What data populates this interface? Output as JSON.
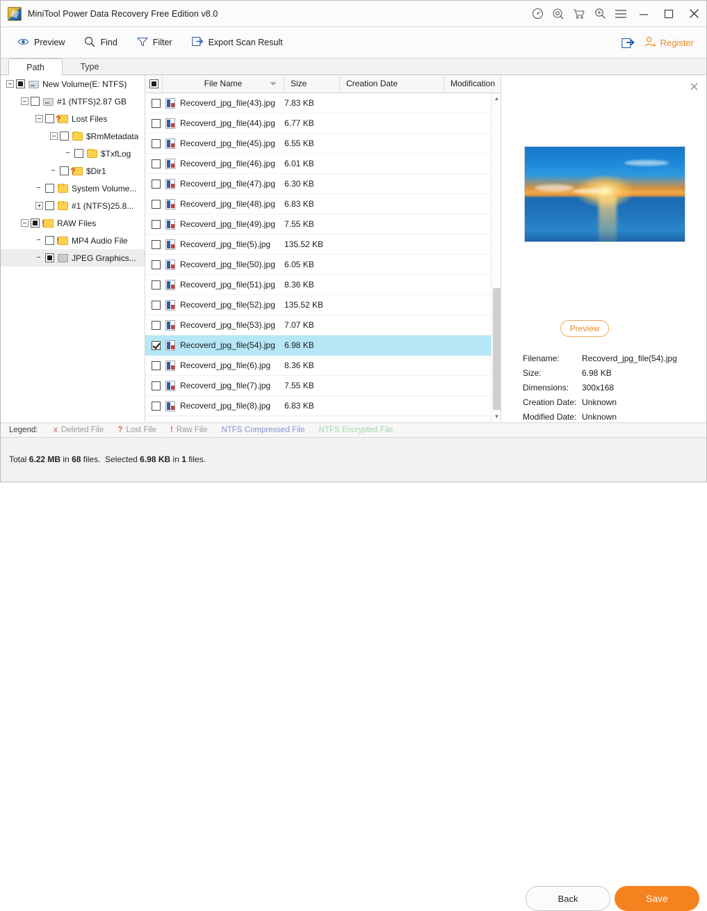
{
  "window": {
    "title": "MiniTool Power Data Recovery Free Edition v8.0",
    "icons": {
      "app": "app-logo-icon",
      "disk": "disk-benchmark-icon",
      "support": "support-icon",
      "cart": "shopping-cart-icon",
      "magnifier": "magnifier-plus-icon",
      "menu": "hamburger-menu-icon",
      "minimize": "minimize-icon",
      "maximize": "maximize-icon",
      "close": "close-icon"
    }
  },
  "toolbar": {
    "preview": "Preview",
    "find": "Find",
    "filter": "Filter",
    "export": "Export Scan Result",
    "share": "share-export-icon",
    "register": "Register"
  },
  "tabs": [
    {
      "label": "Path",
      "active": true
    },
    {
      "label": "Type",
      "active": false
    }
  ],
  "tree": [
    {
      "label": "New Volume(E: NTFS)",
      "indent": 0,
      "expander": "minus",
      "check": "filled",
      "icon": "drive",
      "selected": false
    },
    {
      "label": "#1 (NTFS)2.87 GB",
      "indent": 1,
      "expander": "minus",
      "check": "empty",
      "icon": "drive",
      "selected": false
    },
    {
      "label": "Lost Files",
      "indent": 2,
      "expander": "minus",
      "check": "empty",
      "icon": "quest",
      "selected": false
    },
    {
      "label": "$RmMetadata",
      "indent": 3,
      "expander": "minus",
      "check": "empty",
      "icon": "folder",
      "selected": false
    },
    {
      "label": "$TxfLog",
      "indent": 4,
      "expander": "none",
      "check": "empty",
      "icon": "folder",
      "selected": false
    },
    {
      "label": "$Dir1",
      "indent": 3,
      "expander": "none",
      "check": "empty",
      "icon": "quest",
      "selected": false
    },
    {
      "label": "System Volume...",
      "indent": 2,
      "expander": "none",
      "check": "empty",
      "icon": "folder",
      "selected": false
    },
    {
      "label": "#1 (NTFS)25.8...",
      "indent": 2,
      "expander": "plus",
      "check": "empty",
      "icon": "folder",
      "selected": false
    },
    {
      "label": "RAW Files",
      "indent": 1,
      "expander": "minus",
      "check": "filled",
      "icon": "warn",
      "selected": false
    },
    {
      "label": "MP4 Audio File",
      "indent": 2,
      "expander": "none",
      "check": "empty",
      "icon": "warn",
      "selected": false
    },
    {
      "label": "JPEG Graphics...",
      "indent": 2,
      "expander": "none",
      "check": "filled",
      "icon": "gray",
      "selected": true
    }
  ],
  "list": {
    "headers": {
      "select_all": "select-all-checkbox",
      "name": "File Name",
      "size": "Size",
      "created": "Creation Date",
      "modified": "Modification"
    },
    "rows": [
      {
        "name": "Recoverd_jpg_file(43).jpg",
        "size": "7.83 KB",
        "checked": false,
        "selected": false
      },
      {
        "name": "Recoverd_jpg_file(44).jpg",
        "size": "6.77 KB",
        "checked": false,
        "selected": false
      },
      {
        "name": "Recoverd_jpg_file(45).jpg",
        "size": "6.55 KB",
        "checked": false,
        "selected": false
      },
      {
        "name": "Recoverd_jpg_file(46).jpg",
        "size": "6.01 KB",
        "checked": false,
        "selected": false
      },
      {
        "name": "Recoverd_jpg_file(47).jpg",
        "size": "6.30 KB",
        "checked": false,
        "selected": false
      },
      {
        "name": "Recoverd_jpg_file(48).jpg",
        "size": "6.83 KB",
        "checked": false,
        "selected": false
      },
      {
        "name": "Recoverd_jpg_file(49).jpg",
        "size": "7.55 KB",
        "checked": false,
        "selected": false
      },
      {
        "name": "Recoverd_jpg_file(5).jpg",
        "size": "135.52 KB",
        "checked": false,
        "selected": false
      },
      {
        "name": "Recoverd_jpg_file(50).jpg",
        "size": "6.05 KB",
        "checked": false,
        "selected": false
      },
      {
        "name": "Recoverd_jpg_file(51).jpg",
        "size": "8.36 KB",
        "checked": false,
        "selected": false
      },
      {
        "name": "Recoverd_jpg_file(52).jpg",
        "size": "135.52 KB",
        "checked": false,
        "selected": false
      },
      {
        "name": "Recoverd_jpg_file(53).jpg",
        "size": "7.07 KB",
        "checked": false,
        "selected": false
      },
      {
        "name": "Recoverd_jpg_file(54).jpg",
        "size": "6.98 KB",
        "checked": true,
        "selected": true
      },
      {
        "name": "Recoverd_jpg_file(6).jpg",
        "size": "8.36 KB",
        "checked": false,
        "selected": false
      },
      {
        "name": "Recoverd_jpg_file(7).jpg",
        "size": "7.55 KB",
        "checked": false,
        "selected": false
      },
      {
        "name": "Recoverd_jpg_file(8).jpg",
        "size": "6.83 KB",
        "checked": false,
        "selected": false
      }
    ]
  },
  "preview": {
    "close": "close-icon",
    "button": "Preview",
    "image_alt": "sunset-over-ocean-thumbnail",
    "meta": [
      {
        "key": "Filename:",
        "value": "Recoverd_jpg_file(54).jpg"
      },
      {
        "key": "Size:",
        "value": "6.98 KB"
      },
      {
        "key": "Dimensions:",
        "value": "300x168"
      },
      {
        "key": "Creation Date:",
        "value": "Unknown"
      },
      {
        "key": "Modified Date:",
        "value": "Unknown"
      }
    ]
  },
  "legend": {
    "title": "Legend:",
    "items": [
      {
        "mark": "x",
        "label": "Deleted File",
        "mark_color": "#e08a8a",
        "text_color": "#9a9a9a"
      },
      {
        "mark": "?",
        "label": "Lost File",
        "mark_color": "#e06a5a",
        "text_color": "#9a9a9a"
      },
      {
        "mark": "!",
        "label": "Raw File",
        "mark_color": "#e05a6a",
        "text_color": "#9a9a9a"
      },
      {
        "mark": "",
        "label": "NTFS Compressed File",
        "mark_color": "#8a90d8",
        "text_color": "#8a90d8"
      },
      {
        "mark": "",
        "label": "NTFS Encrypted File",
        "mark_color": "#9ad8a8",
        "text_color": "#9ad8a8"
      }
    ]
  },
  "status": {
    "total_prefix": "Total ",
    "total_size": "6.22 MB",
    "total_mid": " in ",
    "total_count": "68",
    "total_suffix": " files.",
    "sel_prefix": "Selected ",
    "sel_size": "6.98 KB",
    "sel_mid": " in ",
    "sel_count": "1",
    "sel_suffix": " files."
  },
  "footer": {
    "back": "Back",
    "save": "Save"
  },
  "colors": {
    "accent_orange": "#f5821f",
    "selection_blue": "#b6e7f7",
    "link_blue": "#2a6bb5"
  }
}
